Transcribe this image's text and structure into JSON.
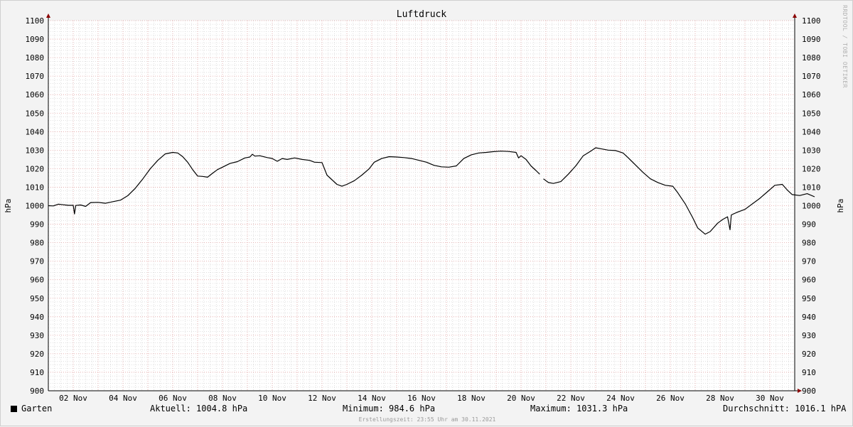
{
  "chart_data": {
    "type": "line",
    "title": "Luftdruck",
    "ylabel": "hPa",
    "ylabel_right": "hPa",
    "ylim": [
      900,
      1100
    ],
    "yticks": [
      900,
      910,
      920,
      930,
      940,
      950,
      960,
      970,
      980,
      990,
      1000,
      1010,
      1020,
      1030,
      1040,
      1050,
      1060,
      1070,
      1080,
      1090,
      1100
    ],
    "xlim": [
      1,
      31
    ],
    "xticks": [
      {
        "day": 2,
        "label": "02 Nov"
      },
      {
        "day": 4,
        "label": "04 Nov"
      },
      {
        "day": 6,
        "label": "06 Nov"
      },
      {
        "day": 8,
        "label": "08 Nov"
      },
      {
        "day": 10,
        "label": "10 Nov"
      },
      {
        "day": 12,
        "label": "12 Nov"
      },
      {
        "day": 14,
        "label": "14 Nov"
      },
      {
        "day": 16,
        "label": "16 Nov"
      },
      {
        "day": 18,
        "label": "18 Nov"
      },
      {
        "day": 20,
        "label": "20 Nov"
      },
      {
        "day": 22,
        "label": "22 Nov"
      },
      {
        "day": 24,
        "label": "24 Nov"
      },
      {
        "day": 26,
        "label": "26 Nov"
      },
      {
        "day": 28,
        "label": "28 Nov"
      },
      {
        "day": 30,
        "label": "30 Nov"
      }
    ],
    "grid": true,
    "colors": {
      "line": "#000000",
      "major_grid": "#e0a0a0",
      "minor_grid": "#cccccc",
      "plot_bg": "#ffffff",
      "axis_arrow": "#8b0000"
    },
    "series": [
      {
        "name": "Garten",
        "segments": [
          [
            [
              1.0,
              1000.0
            ],
            [
              1.2,
              999.9
            ],
            [
              1.4,
              1000.8
            ],
            [
              1.6,
              1000.5
            ],
            [
              1.8,
              1000.2
            ],
            [
              2.0,
              1000.2
            ],
            [
              2.05,
              995.5
            ],
            [
              2.1,
              1000.1
            ],
            [
              2.3,
              1000.4
            ],
            [
              2.5,
              999.6
            ],
            [
              2.7,
              1001.7
            ],
            [
              3.0,
              1001.8
            ],
            [
              3.3,
              1001.3
            ],
            [
              3.6,
              1002.2
            ],
            [
              3.9,
              1003.0
            ],
            [
              4.2,
              1005.5
            ],
            [
              4.5,
              1009.5
            ],
            [
              4.8,
              1014.5
            ],
            [
              5.1,
              1020.0
            ],
            [
              5.4,
              1024.5
            ],
            [
              5.7,
              1028.0
            ],
            [
              6.0,
              1028.8
            ],
            [
              6.2,
              1028.5
            ],
            [
              6.4,
              1026.5
            ],
            [
              6.6,
              1023.5
            ],
            [
              6.8,
              1019.5
            ],
            [
              7.0,
              1016.0
            ],
            [
              7.2,
              1015.8
            ],
            [
              7.4,
              1015.4
            ],
            [
              7.6,
              1017.5
            ],
            [
              7.8,
              1019.5
            ],
            [
              8.0,
              1020.8
            ],
            [
              8.3,
              1022.8
            ],
            [
              8.6,
              1023.8
            ],
            [
              8.9,
              1025.8
            ],
            [
              9.1,
              1026.3
            ],
            [
              9.2,
              1027.8
            ],
            [
              9.3,
              1026.8
            ],
            [
              9.5,
              1027.0
            ],
            [
              9.8,
              1026.0
            ],
            [
              10.0,
              1025.5
            ],
            [
              10.2,
              1024.0
            ],
            [
              10.4,
              1025.5
            ],
            [
              10.6,
              1025.0
            ],
            [
              10.9,
              1025.8
            ],
            [
              11.2,
              1025.0
            ],
            [
              11.5,
              1024.5
            ],
            [
              11.7,
              1023.5
            ],
            [
              12.0,
              1023.3
            ],
            [
              12.2,
              1016.5
            ],
            [
              12.4,
              1014.0
            ],
            [
              12.6,
              1011.5
            ],
            [
              12.8,
              1010.5
            ],
            [
              13.0,
              1011.5
            ],
            [
              13.3,
              1013.5
            ],
            [
              13.6,
              1016.5
            ],
            [
              13.9,
              1020.0
            ],
            [
              14.1,
              1023.5
            ],
            [
              14.4,
              1025.5
            ],
            [
              14.7,
              1026.5
            ],
            [
              15.0,
              1026.3
            ],
            [
              15.3,
              1026.0
            ],
            [
              15.6,
              1025.5
            ],
            [
              15.9,
              1024.5
            ],
            [
              16.2,
              1023.5
            ],
            [
              16.5,
              1021.8
            ],
            [
              16.8,
              1021.0
            ],
            [
              17.1,
              1020.8
            ],
            [
              17.4,
              1021.5
            ],
            [
              17.7,
              1025.5
            ],
            [
              18.0,
              1027.5
            ],
            [
              18.3,
              1028.5
            ],
            [
              18.6,
              1028.8
            ],
            [
              18.9,
              1029.2
            ],
            [
              19.2,
              1029.5
            ],
            [
              19.5,
              1029.3
            ],
            [
              19.8,
              1028.8
            ],
            [
              19.9,
              1025.8
            ],
            [
              20.0,
              1027.0
            ],
            [
              20.2,
              1025.0
            ],
            [
              20.4,
              1021.5
            ],
            [
              20.6,
              1019.0
            ],
            [
              20.75,
              1017.0
            ]
          ],
          [
            [
              20.9,
              1014.5
            ],
            [
              21.1,
              1012.5
            ],
            [
              21.3,
              1012.0
            ],
            [
              21.6,
              1013.0
            ],
            [
              21.9,
              1017.0
            ],
            [
              22.2,
              1021.5
            ],
            [
              22.5,
              1027.0
            ],
            [
              22.8,
              1029.5
            ],
            [
              23.0,
              1031.3
            ],
            [
              23.2,
              1030.8
            ],
            [
              23.5,
              1030.0
            ],
            [
              23.8,
              1029.8
            ],
            [
              24.1,
              1028.5
            ],
            [
              24.3,
              1026.0
            ],
            [
              24.6,
              1022.0
            ],
            [
              24.9,
              1018.0
            ],
            [
              25.2,
              1014.5
            ],
            [
              25.5,
              1012.5
            ],
            [
              25.8,
              1011.0
            ],
            [
              26.1,
              1010.5
            ],
            [
              26.3,
              1007.0
            ],
            [
              26.6,
              1001.0
            ],
            [
              26.9,
              993.5
            ],
            [
              27.1,
              988.0
            ],
            [
              27.4,
              984.6
            ],
            [
              27.6,
              986.0
            ],
            [
              27.9,
              990.5
            ],
            [
              28.1,
              992.5
            ],
            [
              28.3,
              994.0
            ],
            [
              28.4,
              987.0
            ],
            [
              28.45,
              995.0
            ],
            [
              28.7,
              996.5
            ],
            [
              29.0,
              998.0
            ],
            [
              29.3,
              1001.0
            ],
            [
              29.6,
              1004.0
            ],
            [
              29.9,
              1007.5
            ],
            [
              30.2,
              1011.0
            ],
            [
              30.5,
              1011.5
            ],
            [
              30.7,
              1008.5
            ],
            [
              30.9,
              1006.0
            ],
            [
              31.2,
              1005.5
            ],
            [
              31.5,
              1006.5
            ],
            [
              31.8,
              1004.8
            ]
          ]
        ]
      }
    ]
  },
  "legend": {
    "series_label": "Garten",
    "current": "Aktuell: 1004.8 hPa",
    "minimum": "Minimum: 984.6 hPa",
    "maximum": "Maximum: 1031.3 hPa",
    "average": "Durchschnitt: 1016.1 hPA"
  },
  "footer": "Erstellungszeit: 23:55 Uhr am 30.11.2021",
  "watermark": "RRDTOOL / TOBI OETIKER"
}
